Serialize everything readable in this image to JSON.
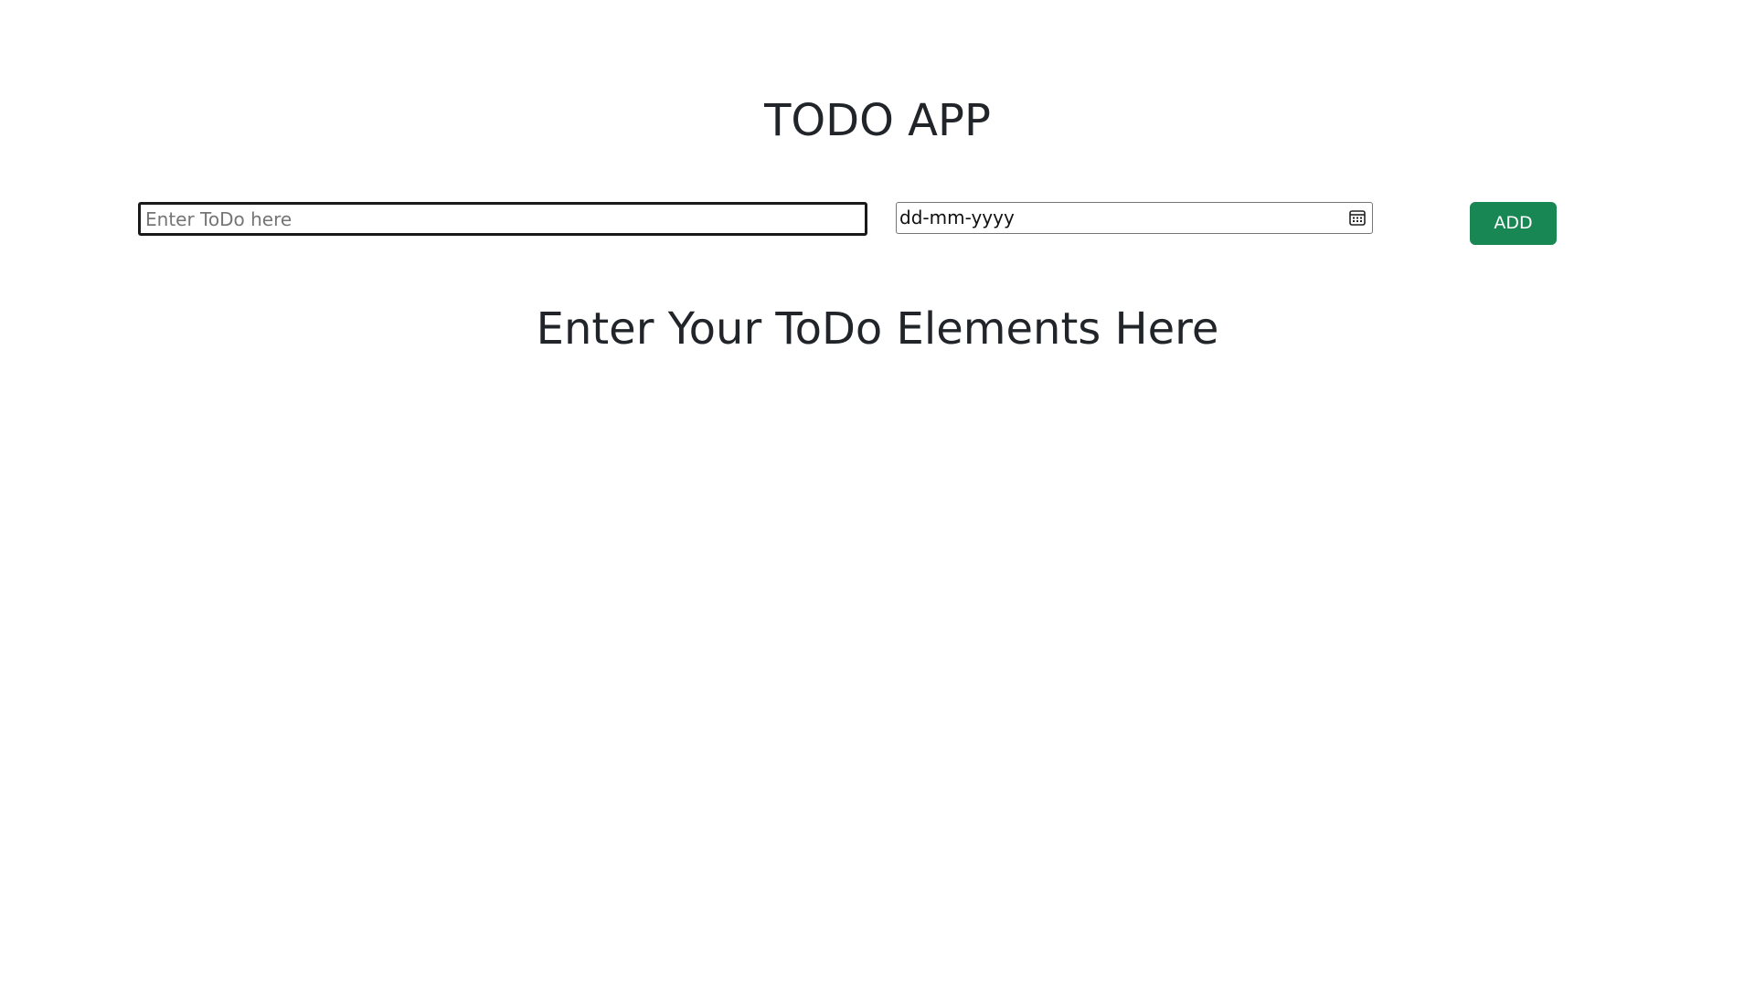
{
  "app": {
    "title": "TODO APP"
  },
  "form": {
    "todo_placeholder": "Enter ToDo here",
    "todo_value": "",
    "date_placeholder": "dd-mm-yyyy",
    "date_icon": "calendar-icon",
    "add_label": "ADD",
    "add_color": "#198754"
  },
  "list": {
    "empty_message": "Enter Your ToDo Elements Here"
  }
}
